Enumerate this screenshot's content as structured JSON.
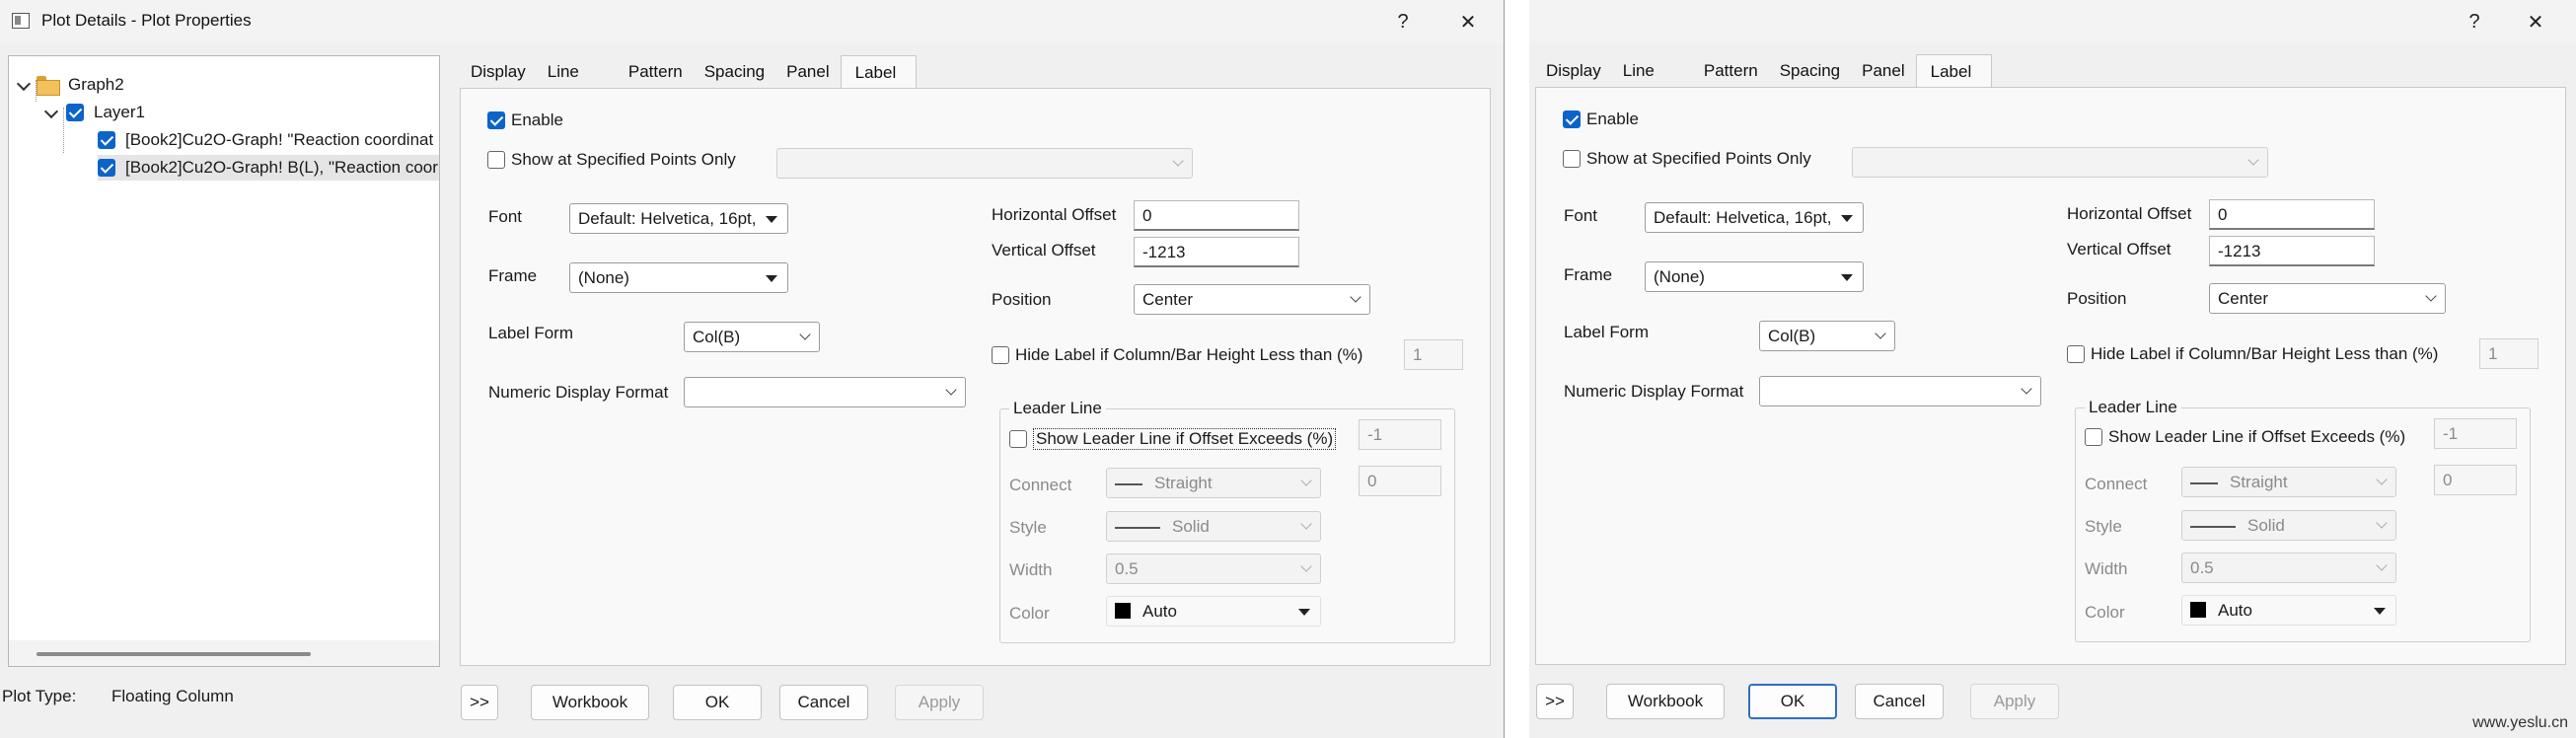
{
  "dialog": {
    "title": "Plot Details - Plot Properties",
    "help_glyph": "?",
    "close_glyph": "✕"
  },
  "tree": {
    "root": "Graph2",
    "layer": "Layer1",
    "items": [
      "[Book2]Cu2O-Graph! \"Reaction coordinat",
      "[Book2]Cu2O-Graph! B(L), \"Reaction coor"
    ]
  },
  "plot_type": {
    "label": "Plot Type:",
    "value": "Floating Column"
  },
  "tabs": [
    "Display",
    "Line",
    "Pattern",
    "Spacing",
    "Panel",
    "Label"
  ],
  "active_tab": "Label",
  "label_tab": {
    "enable": "Enable",
    "show_specified": "Show at Specified Points Only",
    "font_label": "Font",
    "font_value": "Default: Helvetica, 16pt,",
    "frame_label": "Frame",
    "frame_value": "(None)",
    "label_form_label": "Label Form",
    "label_form_value": "Col(B)",
    "numeric_format_label": "Numeric Display Format",
    "numeric_format_value": "",
    "h_offset_label": "Horizontal Offset",
    "h_offset_value": "0",
    "v_offset_label": "Vertical Offset",
    "v_offset_value": "-1213",
    "position_label": "Position",
    "position_value": "Center",
    "hide_label": "Hide Label if Column/Bar Height Less than (%)",
    "hide_value": "1",
    "leader_title": "Leader Line",
    "leader_show": "Show Leader Line if Offset Exceeds (%)",
    "leader_show_value": "-1",
    "connect_label": "Connect",
    "connect_value": "Straight",
    "connect_num": "0",
    "style_label": "Style",
    "style_value": "Solid",
    "width_label": "Width",
    "width_value": "0.5",
    "color_label": "Color",
    "color_value": "Auto"
  },
  "buttons": {
    "expand": ">>",
    "workbook": "Workbook",
    "ok": "OK",
    "cancel": "Cancel",
    "apply": "Apply"
  },
  "watermark": "www.yeslu.cn",
  "colors": {
    "check_blue": "#0a64c9",
    "default_button_border": "#2f6fbf"
  }
}
